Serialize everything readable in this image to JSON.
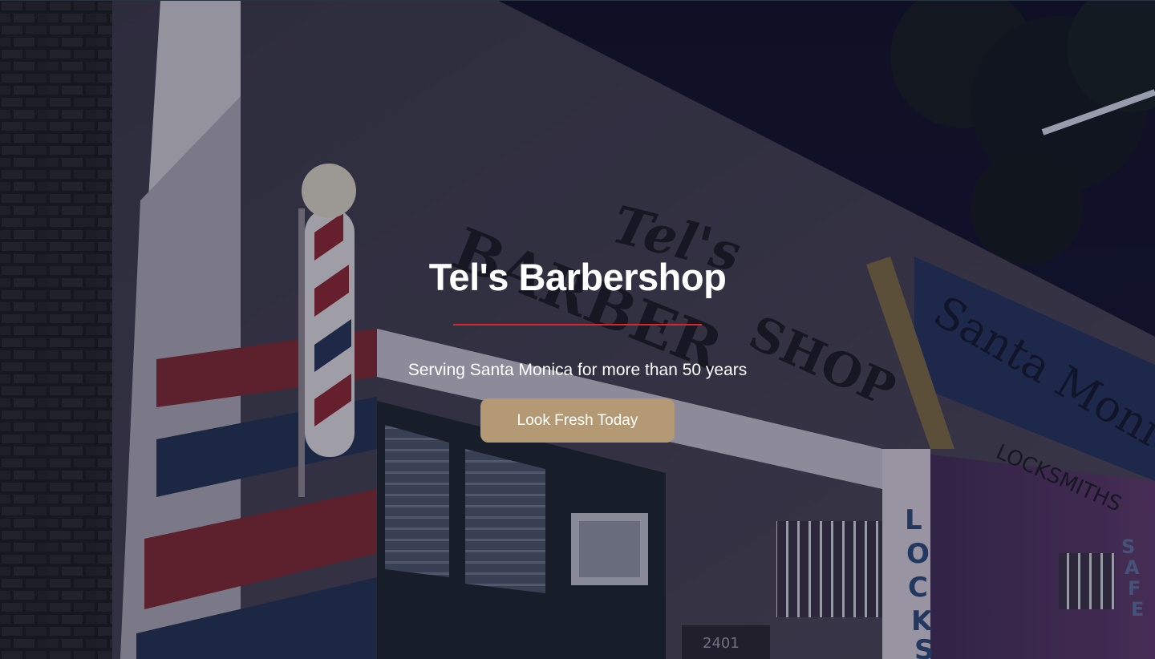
{
  "hero": {
    "title": "Tel's Barbershop",
    "subtitle": "Serving Santa Monica for more than 50 years",
    "cta_label": "Look Fresh Today",
    "background": "night-storefront-photo"
  },
  "colors": {
    "accent_rule": "#d9262c",
    "cta_background": "#b39a74",
    "text": "#ffffff"
  },
  "photo_text": {
    "sign_script": "Tel's",
    "sign_main": "BARBER SHOP",
    "side_sign": "Santa Monica",
    "side_sub": "LOCKSMITHS",
    "vertical_sign": "LOCKS",
    "safe_sign": "SAFE",
    "door_number": "2401"
  }
}
